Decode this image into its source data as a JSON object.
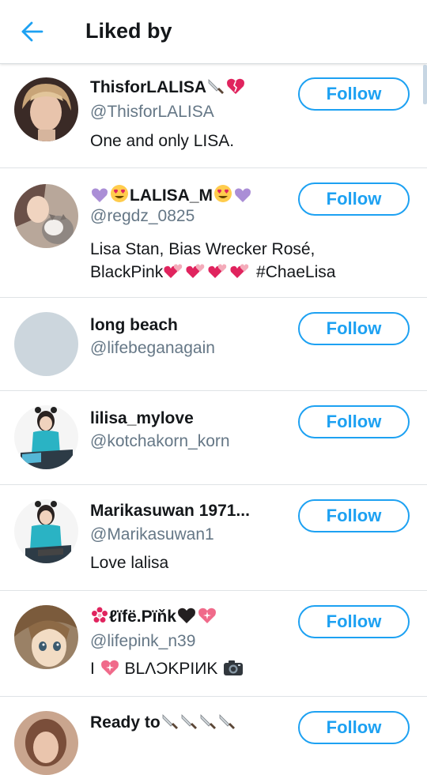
{
  "header": {
    "title": "Liked by"
  },
  "users": [
    {
      "name": "ThisforLALISA",
      "name_emojis": [
        "knife",
        "broken-heart"
      ],
      "handle": "@ThisforLALISA",
      "bio": "One and only LISA.",
      "follow_label": "Follow"
    },
    {
      "name_prefix_emojis": [
        "purple-heart",
        "heart-eyes"
      ],
      "name": "LALISA_M",
      "name_emojis": [
        "heart-eyes",
        "purple-heart"
      ],
      "handle": "@regdz_0825",
      "bio": "Lisa Stan, Bias Wrecker Rosé,",
      "bio2": "BlackPink",
      "bio2_emojis": [
        "two-hearts",
        "two-hearts",
        "two-hearts",
        "two-hearts"
      ],
      "bio2_tail": " #ChaeLisa",
      "follow_label": "Follow"
    },
    {
      "name": "long beach",
      "handle": "@lifebeganagain",
      "follow_label": "Follow"
    },
    {
      "name": "lilisa_mylove",
      "handle": "@kotchakorn_korn",
      "follow_label": "Follow"
    },
    {
      "name": "Marikasuwan 1971...",
      "handle": "@Marikasuwan1",
      "bio": "Love lalisa",
      "follow_label": "Follow"
    },
    {
      "name_prefix_emojis": [
        "pink-flower"
      ],
      "name": "ℓïfë.Pïňk",
      "name_emojis": [
        "black-heart",
        "sparkling-heart"
      ],
      "handle": "@lifepink_n39",
      "bio_prefix": "I ",
      "bio_prefix_emoji": "sparkling-heart",
      "bio": " BLΛƆKPIИK ",
      "bio_emoji": "camera",
      "follow_label": "Follow"
    },
    {
      "name": "Ready to",
      "name_emojis": [
        "knife",
        "knife",
        "knife",
        "knife"
      ],
      "follow_label": "Follow"
    }
  ],
  "colors": {
    "accent": "#1da1f2",
    "handle": "#657786",
    "divider": "#dfe3e6"
  },
  "icons": {
    "back": "arrow-left-icon"
  }
}
